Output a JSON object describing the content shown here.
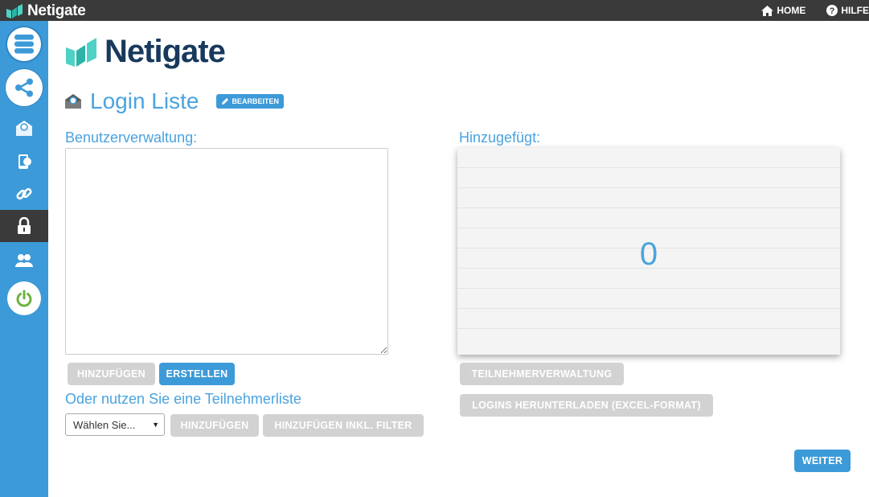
{
  "topbar": {
    "brand": "Netigate",
    "home": "HOME",
    "help": "HILFE"
  },
  "sidebar": {
    "items": [
      {
        "icon": "database-icon"
      },
      {
        "icon": "share-icon"
      },
      {
        "icon": "email-icon"
      },
      {
        "icon": "mobile-icon"
      },
      {
        "icon": "link-icon"
      },
      {
        "icon": "lock-icon"
      },
      {
        "icon": "users-icon"
      },
      {
        "icon": "power-icon"
      }
    ]
  },
  "logo": {
    "text": "Netigate"
  },
  "page": {
    "title": "Login Liste",
    "edit_label": "BEARBEITEN"
  },
  "left": {
    "label": "Benutzerverwaltung:",
    "textarea_value": "",
    "add_label": "HINZUFÜGEN",
    "create_label": "ERSTELLEN",
    "alt_label": "Oder nutzen Sie eine Teilnehmerliste",
    "select_value": "Wählen Sie...",
    "add2_label": "HINZUFÜGEN",
    "add_filter_label": "HINZUFÜGEN INKL. FILTER"
  },
  "right": {
    "label": "Hinzugefügt:",
    "count": "0",
    "manage_label": "TEILNEHMERVERWALTUNG",
    "download_label": "LOGINS HERUNTERLADEN (EXCEL-FORMAT)"
  },
  "footer": {
    "next_label": "WEITER"
  },
  "colors": {
    "accent": "#3d9ad8",
    "title": "#4aa3df",
    "dark": "#3a3a3a",
    "logo_text": "#17395c",
    "power": "#6cb33f"
  }
}
